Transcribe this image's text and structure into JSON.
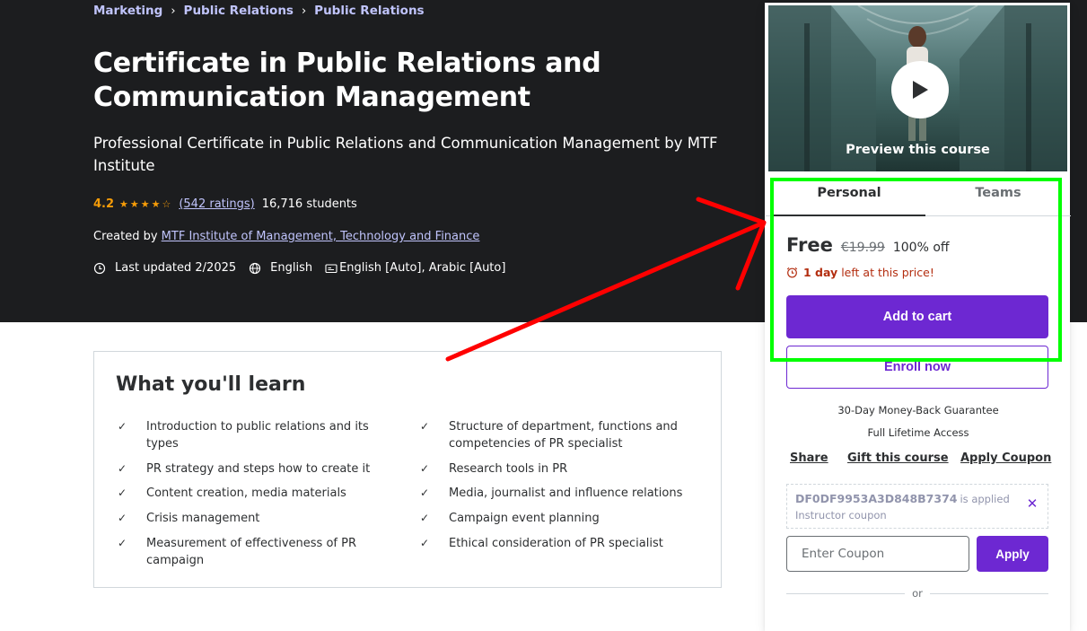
{
  "breadcrumb": [
    "Marketing",
    "Public Relations",
    "Public Relations"
  ],
  "course": {
    "title": "Certificate in Public Relations and Communication Management",
    "subtitle": "Professional Certificate in Public Relations and Communication Management by MTF Institute",
    "rating": "4.2",
    "ratings_link": "(542 ratings)",
    "students": "16,716 students",
    "created_by_label": "Created by",
    "creator": "MTF Institute of Management, Technology and Finance",
    "last_updated": "Last updated 2/2025",
    "language": "English",
    "captions": "English [Auto], Arabic [Auto]"
  },
  "learn": {
    "title": "What you'll learn",
    "left": [
      "Introduction to public relations and its types",
      "PR strategy and steps how to create it",
      "Content creation, media materials",
      "Crisis management",
      "Measurement of effectiveness of PR campaign"
    ],
    "right": [
      "Structure of department, functions and competencies of PR specialist",
      "Research tools in PR",
      "Media, journalist and influence relations",
      "Campaign event planning",
      "Ethical consideration of PR specialist"
    ]
  },
  "sidebar": {
    "preview_label": "Preview this course",
    "tabs": [
      "Personal",
      "Teams"
    ],
    "price_free": "Free",
    "price_original": "€19.99",
    "discount": "100% off",
    "urgency_bold": "1 day",
    "urgency_rest": "left at this price!",
    "add_to_cart": "Add to cart",
    "enroll_now": "Enroll now",
    "guarantee": "30-Day Money-Back Guarantee",
    "lifetime": "Full Lifetime Access",
    "share": "Share",
    "gift": "Gift this course",
    "apply_coupon": "Apply Coupon",
    "coupon_code": "DF0DF9953A3D848B7374",
    "coupon_applied": "is applied",
    "coupon_type": "Instructor coupon",
    "coupon_placeholder": "Enter Coupon",
    "apply": "Apply",
    "or": "or"
  },
  "colors": {
    "accent": "#6d28d2",
    "hero_bg": "#1c1d1f",
    "star": "#f69c08",
    "link_light": "#c0c4fc",
    "urgency": "#b32d0f",
    "annotation_arrow": "#ff0000",
    "annotation_box": "#00ff00"
  }
}
